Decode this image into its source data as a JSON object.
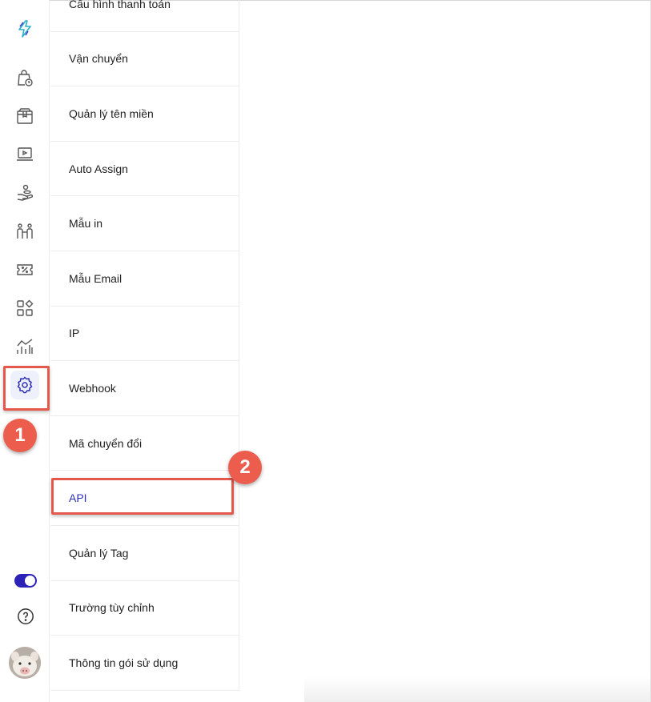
{
  "rail": {
    "icons": [
      {
        "name": "brand-logo-icon"
      },
      {
        "name": "shopping-bag-clock-icon"
      },
      {
        "name": "package-box-icon"
      },
      {
        "name": "laptop-video-icon"
      },
      {
        "name": "hand-coins-icon"
      },
      {
        "name": "users-icon"
      },
      {
        "name": "discount-ticket-icon"
      },
      {
        "name": "apps-grid-icon"
      },
      {
        "name": "analytics-chart-icon"
      },
      {
        "name": "settings-gear-icon"
      }
    ],
    "toggle_on": true,
    "help_icon": "question-circle-icon"
  },
  "annotations": {
    "badge_1": "1",
    "badge_2": "2"
  },
  "settings_menu": {
    "items": [
      {
        "label": "Cấu hình thanh toán"
      },
      {
        "label": "Vận chuyển"
      },
      {
        "label": "Quản lý tên miền"
      },
      {
        "label": "Auto Assign"
      },
      {
        "label": "Mẫu in"
      },
      {
        "label": "Mẫu Email"
      },
      {
        "label": "IP"
      },
      {
        "label": "Webhook"
      },
      {
        "label": "Mã chuyển đổi"
      },
      {
        "label": "API"
      },
      {
        "label": "Quản lý Tag"
      },
      {
        "label": "Trường tùy chỉnh"
      },
      {
        "label": "Thông tin gói sử dụng"
      }
    ],
    "active_item": "API"
  },
  "colors": {
    "accent": "#2d2fb7",
    "highlight": "#e5584c",
    "badge": "#ec5d4e"
  }
}
